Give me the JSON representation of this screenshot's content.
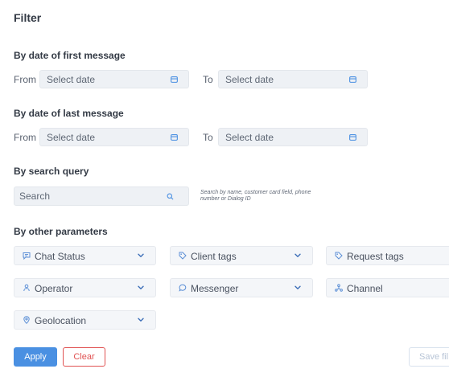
{
  "title": "Filter",
  "first_message": {
    "heading": "By date of first message",
    "from_label": "From",
    "from_placeholder": "Select date",
    "to_label": "To",
    "to_placeholder": "Select date"
  },
  "last_message": {
    "heading": "By date of last message",
    "from_label": "From",
    "from_placeholder": "Select date",
    "to_label": "To",
    "to_placeholder": "Select date"
  },
  "search": {
    "heading": "By search query",
    "placeholder": "Search",
    "hint_line1": "Search by name, customer card field, phone",
    "hint_line2": "number or Dialog ID"
  },
  "other": {
    "heading": "By other parameters",
    "chat_status": "Chat Status",
    "client_tags": "Client tags",
    "request_tags": "Request tags",
    "operator": "Operator",
    "messenger": "Messenger",
    "channel": "Channel",
    "geolocation": "Geolocation"
  },
  "actions": {
    "apply": "Apply",
    "clear": "Clear",
    "save": "Save fil"
  },
  "colors": {
    "accent": "#4a90e2",
    "danger": "#e05252",
    "icon": "#5b8fd6"
  }
}
